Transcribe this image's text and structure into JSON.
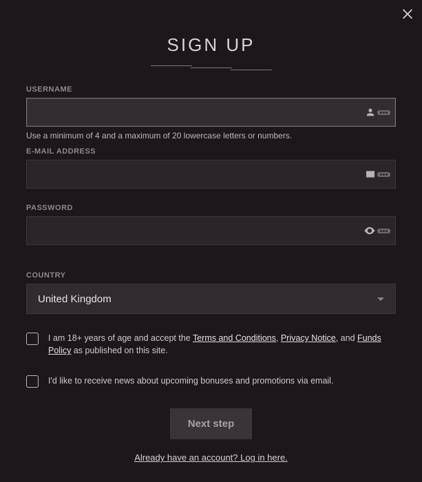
{
  "title": "SIGN UP",
  "close_label": "Close",
  "fields": {
    "username": {
      "label": "USERNAME",
      "value": "",
      "hint": "Use a minimum of 4 and a maximum of 20 lowercase letters or numbers."
    },
    "email": {
      "label": "E-MAIL ADDRESS",
      "value": ""
    },
    "password": {
      "label": "PASSWORD",
      "value": ""
    },
    "country": {
      "label": "COUNTRY",
      "value": "United Kingdom"
    }
  },
  "terms": {
    "prefix": "I am 18+ years of age and accept the ",
    "tnc": "Terms and Conditions",
    "sep1": ", ",
    "privacy": "Privacy Notice",
    "sep2": ", and ",
    "funds": "Funds Policy",
    "suffix": " as published on this site."
  },
  "newsletter_text": "I'd like to receive news about upcoming bonuses and promotions via email.",
  "submit_label": "Next step",
  "login_link": "Already have an account? Log in here."
}
